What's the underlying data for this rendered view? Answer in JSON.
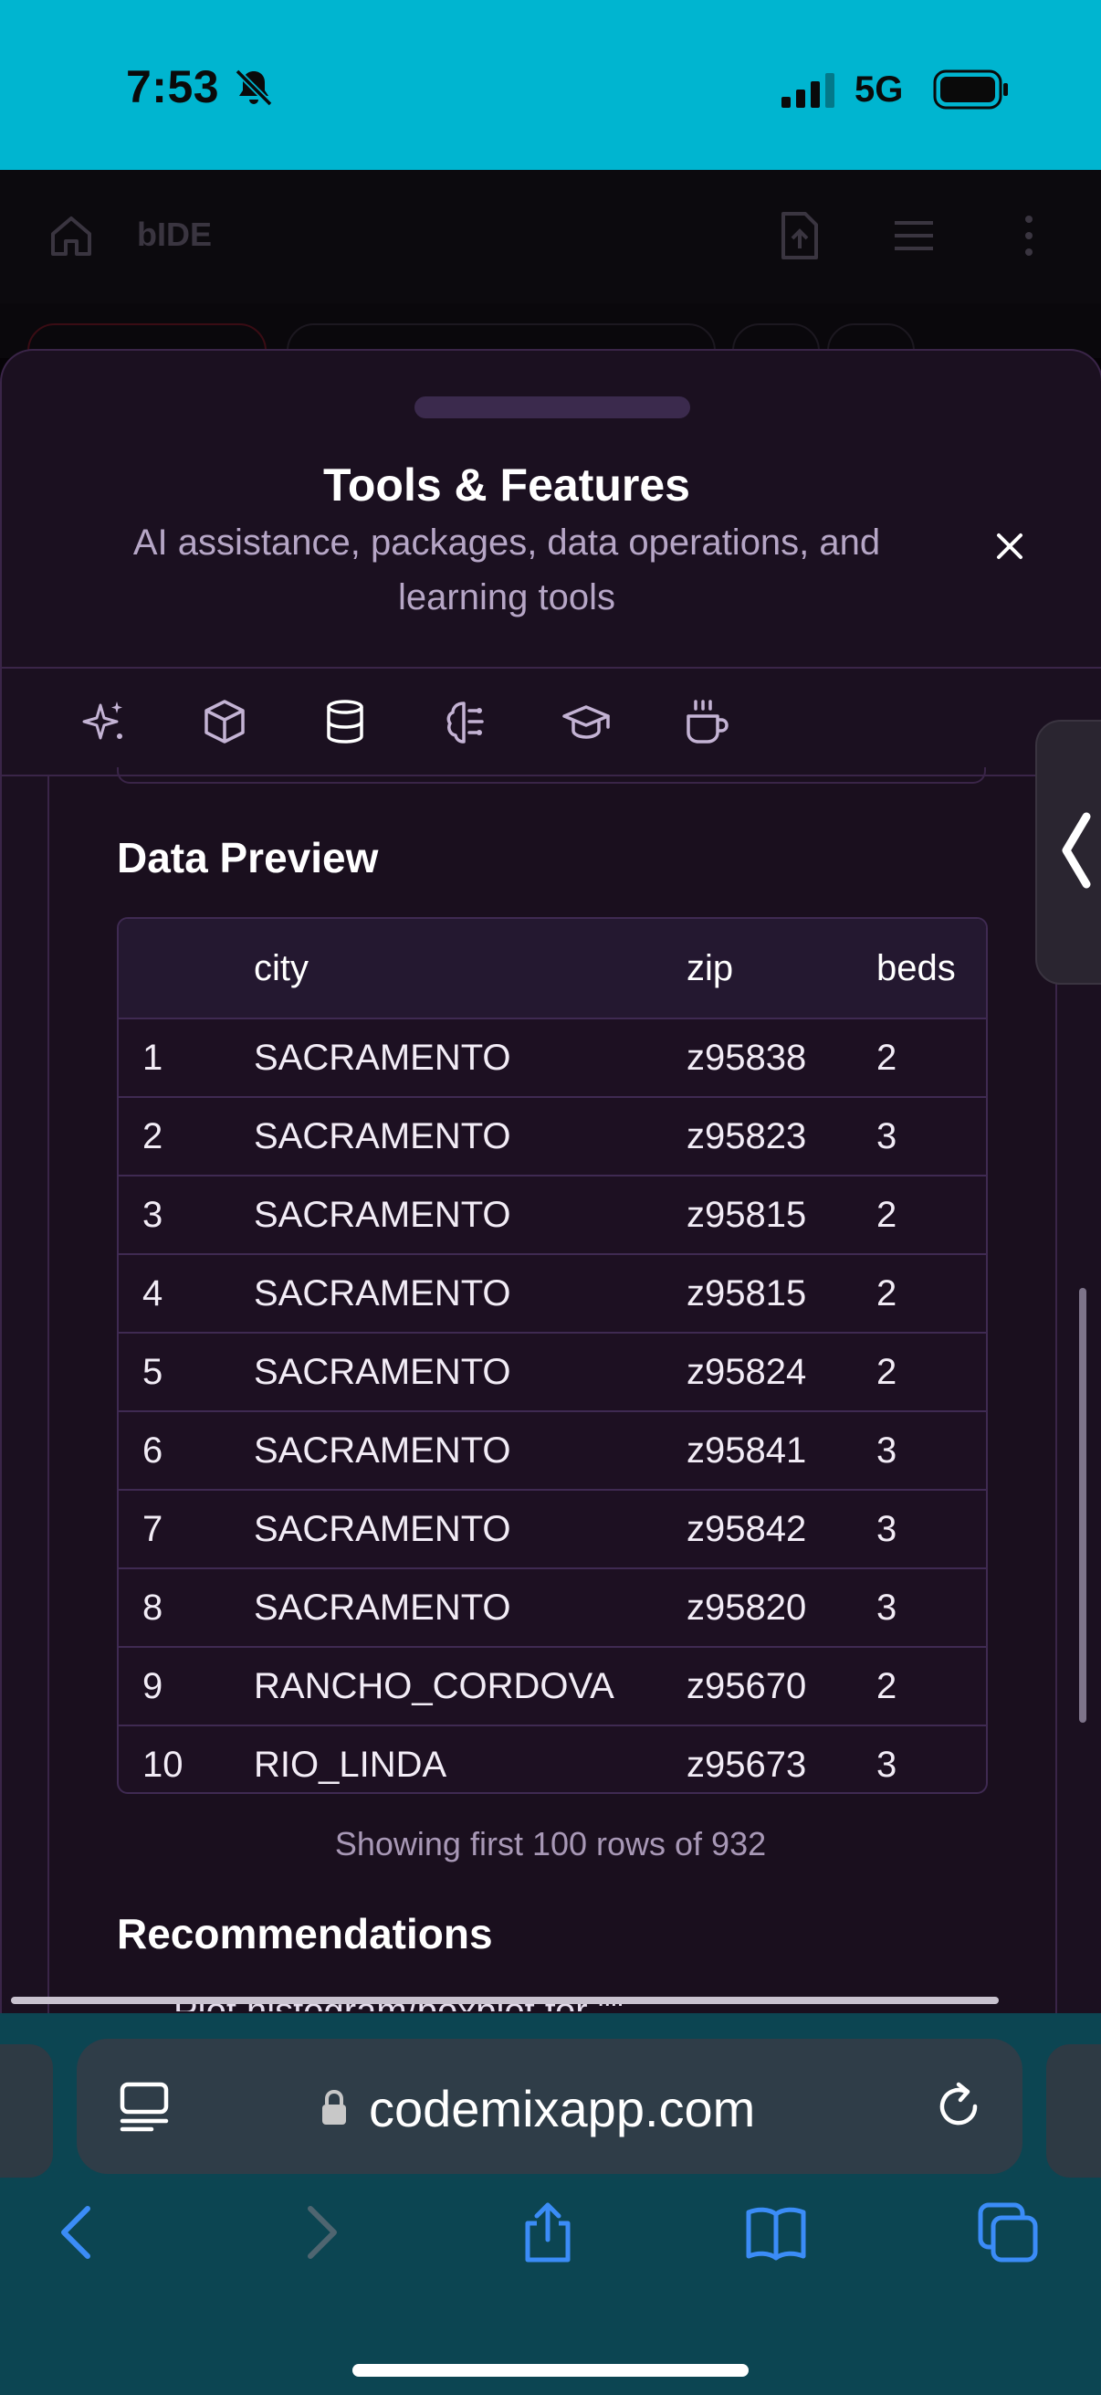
{
  "status_bar": {
    "time": "7:53",
    "network": "5G"
  },
  "app_header": {
    "title": "bIDE"
  },
  "sheet": {
    "title": "Tools & Features",
    "subtitle_line1": "AI assistance, packages, data operations, and",
    "subtitle_line2": "learning tools"
  },
  "tool_tabs": [
    "ai-sparkle-icon",
    "package-icon",
    "database-icon",
    "brain-icon",
    "graduation-cap-icon",
    "coffee-icon"
  ],
  "data_preview": {
    "title": "Data Preview",
    "columns": [
      "",
      "city",
      "zip",
      "beds"
    ],
    "rows": [
      [
        "1",
        "SACRAMENTO",
        "z95838",
        "2"
      ],
      [
        "2",
        "SACRAMENTO",
        "z95823",
        "3"
      ],
      [
        "3",
        "SACRAMENTO",
        "z95815",
        "2"
      ],
      [
        "4",
        "SACRAMENTO",
        "z95815",
        "2"
      ],
      [
        "5",
        "SACRAMENTO",
        "z95824",
        "2"
      ],
      [
        "6",
        "SACRAMENTO",
        "z95841",
        "3"
      ],
      [
        "7",
        "SACRAMENTO",
        "z95842",
        "3"
      ],
      [
        "8",
        "SACRAMENTO",
        "z95820",
        "3"
      ],
      [
        "9",
        "RANCHO_CORDOVA",
        "z95670",
        "2"
      ],
      [
        "10",
        "RIO_LINDA",
        "z95673",
        "3"
      ]
    ],
    "rows_note": "Showing first 100 rows of 932"
  },
  "recommendations": {
    "title": "Recommendations",
    "first_item": "Plot histogram/boxplot for \"\""
  },
  "browser": {
    "url": "codemixapp.com"
  },
  "colors": {
    "status_bar": "#00b5d0",
    "sheet_bg": "#1b1020",
    "border": "#3a2548",
    "safari_bar": "#0c4552"
  }
}
